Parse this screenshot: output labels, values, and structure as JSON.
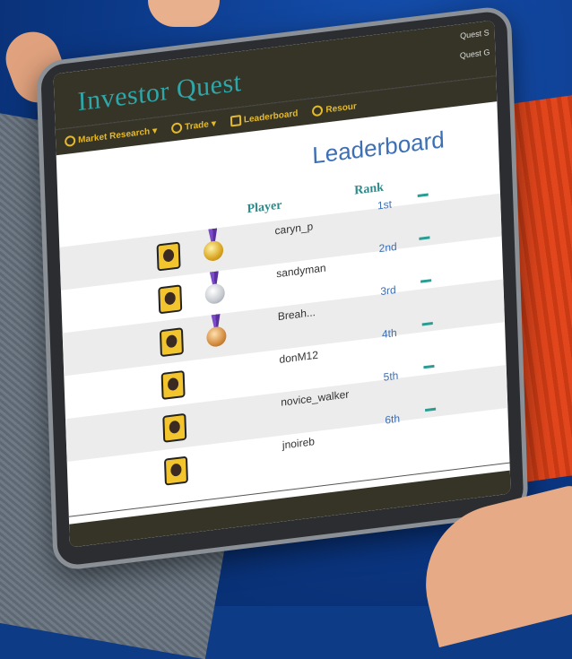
{
  "app": {
    "title": "Investor Quest",
    "quest_links": [
      "Quest S",
      "Quest G"
    ]
  },
  "nav": [
    {
      "label": "Market Research",
      "icon": "magnifier-icon"
    },
    {
      "label": "Trade",
      "icon": "trade-icon"
    },
    {
      "label": "Leaderboard",
      "icon": "trophy-icon"
    },
    {
      "label": "Resour",
      "icon": "resources-icon"
    }
  ],
  "page": {
    "title": "Leaderboard"
  },
  "table": {
    "headers": {
      "player": "Player",
      "rank": "Rank"
    },
    "rows": [
      {
        "player": "caryn_p",
        "rank": "1st",
        "medal": "gold"
      },
      {
        "player": "sandyman",
        "rank": "2nd",
        "medal": "silver"
      },
      {
        "player": "Breah...",
        "rank": "3rd",
        "medal": "bronze"
      },
      {
        "player": "donM12",
        "rank": "4th",
        "medal": ""
      },
      {
        "player": "novice_walker",
        "rank": "5th",
        "medal": ""
      },
      {
        "player": "jnoireb",
        "rank": "6th",
        "medal": ""
      }
    ]
  },
  "colors": {
    "accent": "#2fa6a8",
    "nav_text": "#e4b92c",
    "link": "#3c6fb4",
    "bar": "#363427"
  }
}
